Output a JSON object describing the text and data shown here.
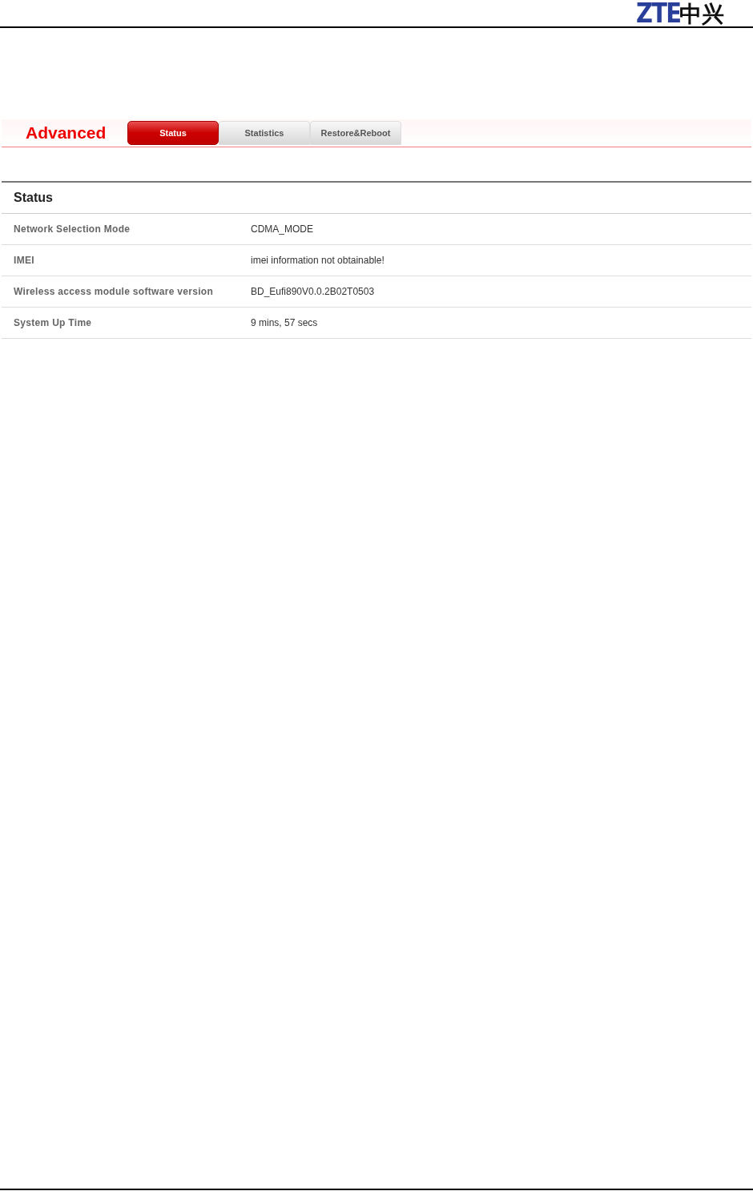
{
  "header": {
    "logo_latin": "ZTE",
    "logo_cjk": "中兴"
  },
  "section_title": "Advanced",
  "tabs": [
    {
      "label": "Status",
      "selected": true
    },
    {
      "label": "Statistics",
      "selected": false
    },
    {
      "label": "Restore&Reboot",
      "selected": false
    }
  ],
  "panel": {
    "title": "Status",
    "rows": [
      {
        "label": "Network Selection Mode",
        "value": "CDMA_MODE"
      },
      {
        "label": "IMEI",
        "value": "imei information not obtainable!"
      },
      {
        "label": "Wireless access module software version",
        "value": "BD_Eufi890V0.0.2B02T0503"
      },
      {
        "label": "System Up Time",
        "value": "9 mins, 57 secs"
      }
    ]
  }
}
